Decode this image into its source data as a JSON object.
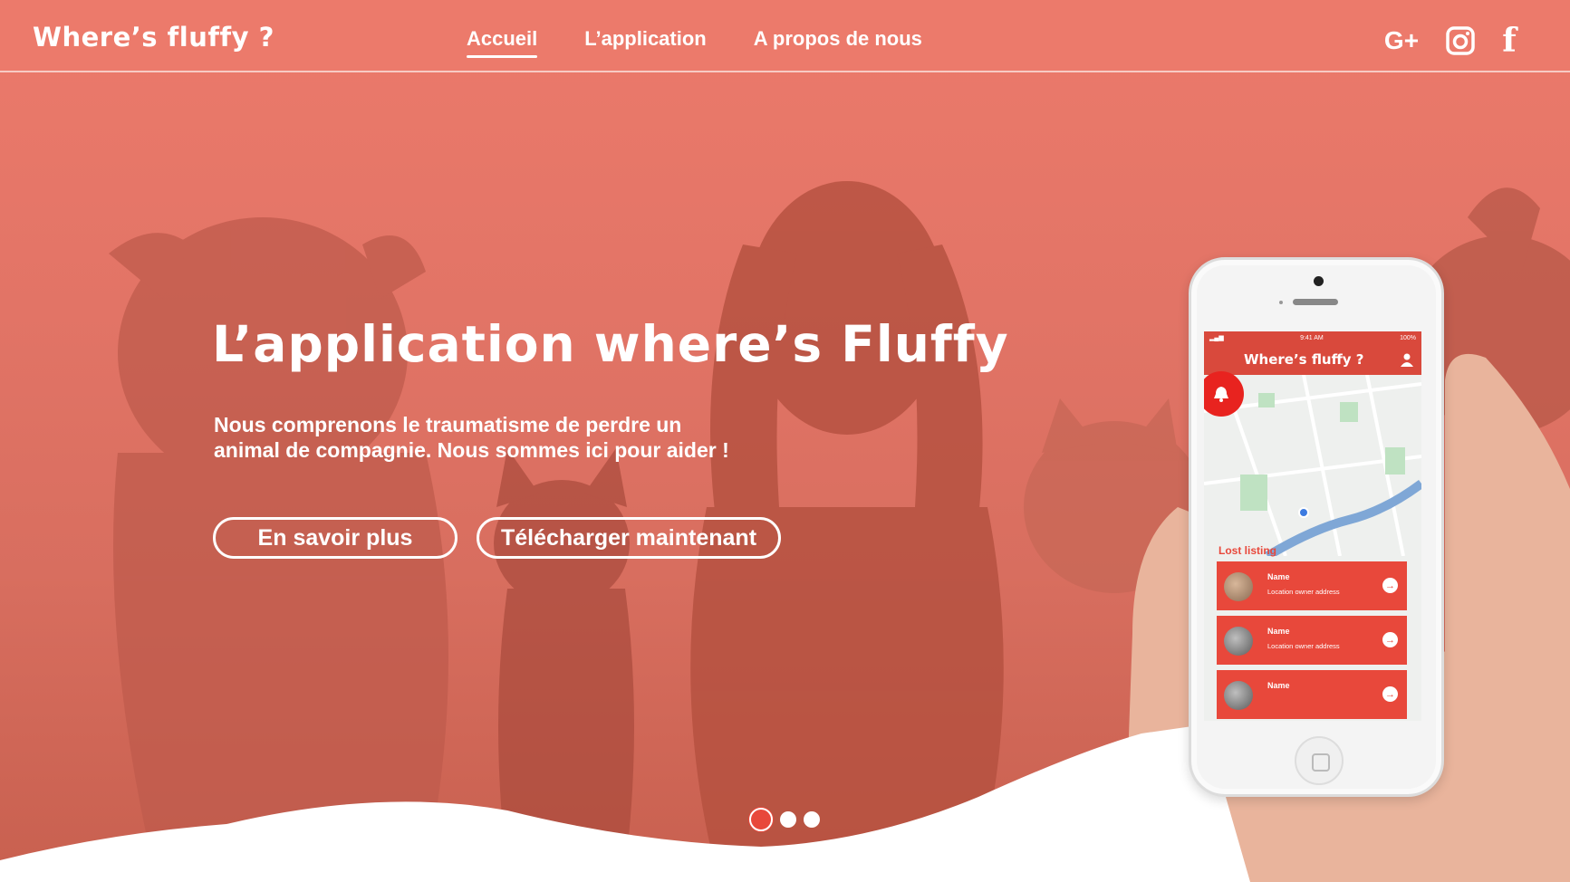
{
  "header": {
    "logo": "Where’s fluffy ?",
    "nav": [
      {
        "label": "Accueil",
        "active": true
      },
      {
        "label": "L’application",
        "active": false
      },
      {
        "label": "A propos de nous",
        "active": false
      }
    ],
    "social": [
      {
        "name": "google-plus-icon",
        "glyph": "G+"
      },
      {
        "name": "instagram-icon",
        "glyph": ""
      },
      {
        "name": "facebook-icon",
        "glyph": "f"
      }
    ]
  },
  "hero": {
    "title": "L’application where’s Fluffy",
    "subtitle_line1": "Nous comprenons le traumatisme de perdre un",
    "subtitle_line2": "animal de compagnie. Nous sommes ici pour aider !",
    "button_more": "En savoir plus",
    "button_download": "Télécharger maintenant"
  },
  "carousel": {
    "count": 3,
    "active": 1
  },
  "phone": {
    "status_time": "9:41 AM",
    "status_battery": "100%",
    "app_title": "Where’s fluffy ?",
    "section_title": "Lost listing",
    "listings": [
      {
        "name": "Name",
        "address": "Location owner address"
      },
      {
        "name": "Name",
        "address": "Location owner address"
      },
      {
        "name": "Name",
        "address": ""
      }
    ]
  },
  "colors": {
    "brand": "#ec7a6b",
    "accent": "#e8483b",
    "alert": "#e8231f"
  }
}
